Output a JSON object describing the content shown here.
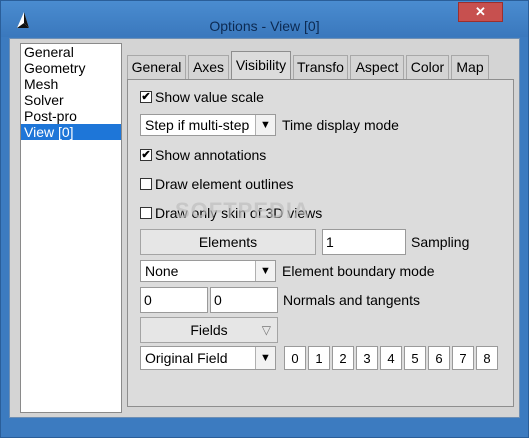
{
  "window": {
    "title": "Options - View [0]",
    "close_symbol": "✕"
  },
  "tree": {
    "items": [
      "General",
      "Geometry",
      "Mesh",
      "Solver",
      "Post-pro",
      "View [0]"
    ],
    "selected_index": 5
  },
  "tabs": [
    "General",
    "Axes",
    "Visibility",
    "Transfo",
    "Aspect",
    "Color",
    "Map"
  ],
  "active_tab": "Visibility",
  "visibility": {
    "show_value_scale": {
      "label": "Show value scale",
      "checked": true
    },
    "time_display": {
      "value": "Step if multi-step",
      "label": "Time display mode"
    },
    "show_annotations": {
      "label": "Show annotations",
      "checked": true
    },
    "draw_element_outlines": {
      "label": "Draw element outlines",
      "checked": false
    },
    "draw_only_skin": {
      "label": "Draw only skin of 3D views",
      "checked": false
    },
    "elements_button": "Elements",
    "sampling": {
      "value": "1",
      "label": "Sampling"
    },
    "boundary_mode": {
      "value": "None",
      "label": "Element boundary mode"
    },
    "normals": {
      "value1": "0",
      "value2": "0",
      "label": "Normals and tangents"
    },
    "fields_button": "Fields",
    "field_select": "Original Field",
    "field_indices": [
      "0",
      "1",
      "2",
      "3",
      "4",
      "5",
      "6",
      "7",
      "8"
    ]
  },
  "watermark": "SOFTPEDIA",
  "icons": {
    "app": "gmsh-logo-icon",
    "check": "✔",
    "dropdown": "▼",
    "fields_arrow": "▽"
  }
}
